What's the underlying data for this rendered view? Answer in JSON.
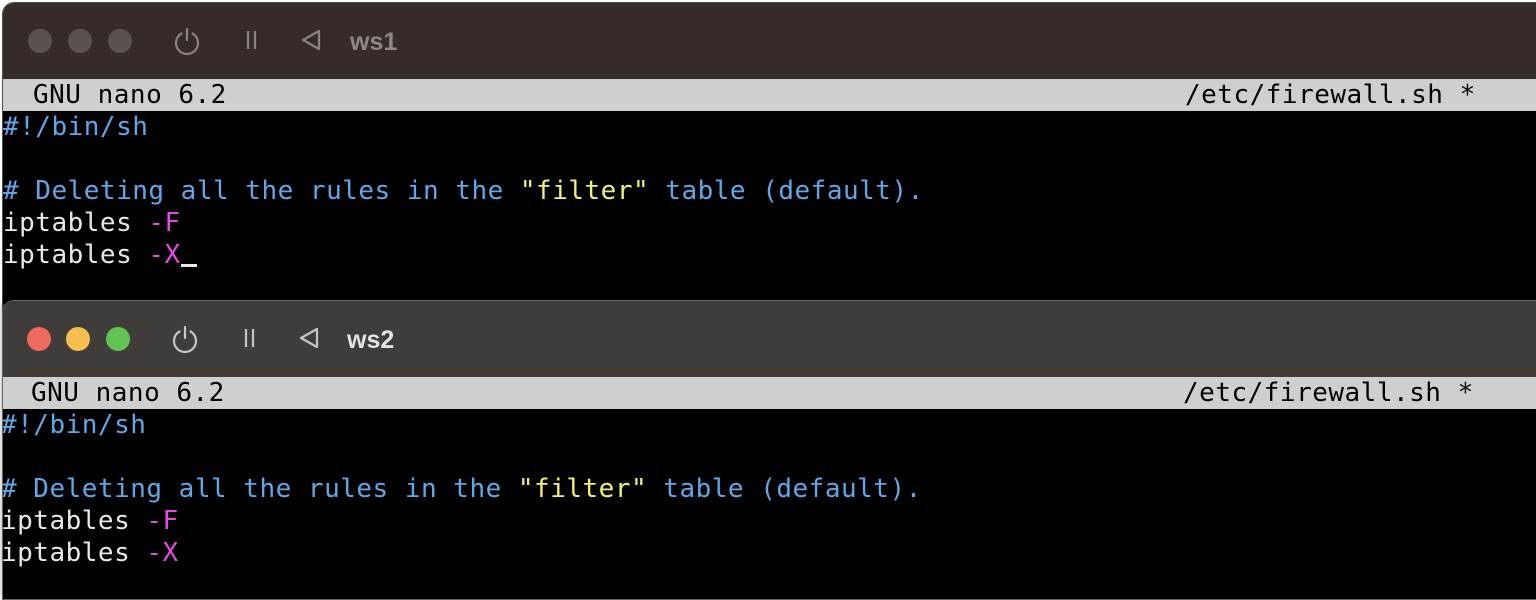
{
  "windows": [
    {
      "title": "ws1",
      "active": false,
      "colors": {
        "light_close": "#5a524f",
        "light_min": "#5a524f",
        "light_max": "#5a524f"
      },
      "editor": {
        "header_left": "GNU nano 6.2",
        "header_right": "/etc/firewall.sh *",
        "lines": [
          {
            "shebang": "#!/bin/sh"
          },
          {
            "blank": ""
          },
          {
            "comment_a": "# Deleting all the rules in the ",
            "string": "\"filter\"",
            "comment_b": " table (default)."
          },
          {
            "cmd": "iptables ",
            "flag": "-F"
          },
          {
            "cmd": "iptables ",
            "flag": "-X"
          }
        ]
      },
      "icons": [
        "power-icon",
        "pause-icon",
        "back-icon"
      ]
    },
    {
      "title": "ws2",
      "active": true,
      "colors": {
        "light_close": "#ed6a5e",
        "light_min": "#f5bf4f",
        "light_max": "#61c554"
      },
      "editor": {
        "header_left": "GNU nano 6.2",
        "header_right": "/etc/firewall.sh *",
        "lines": [
          {
            "shebang": "#!/bin/sh"
          },
          {
            "blank": ""
          },
          {
            "comment_a": "# Deleting all the rules in the ",
            "string": "\"filter\"",
            "comment_b": " table (default)."
          },
          {
            "cmd": "iptables ",
            "flag": "-F"
          },
          {
            "cmd": "iptables ",
            "flag": "-X"
          }
        ]
      },
      "icons": [
        "power-icon",
        "pause-icon",
        "back-icon"
      ]
    }
  ],
  "syntax_colors": {
    "comment": "#5fa8e8",
    "string": "#f3f36b",
    "flag": "#e34ce3",
    "text": "#e8e8e8",
    "header_bg": "#cfcfcf"
  }
}
